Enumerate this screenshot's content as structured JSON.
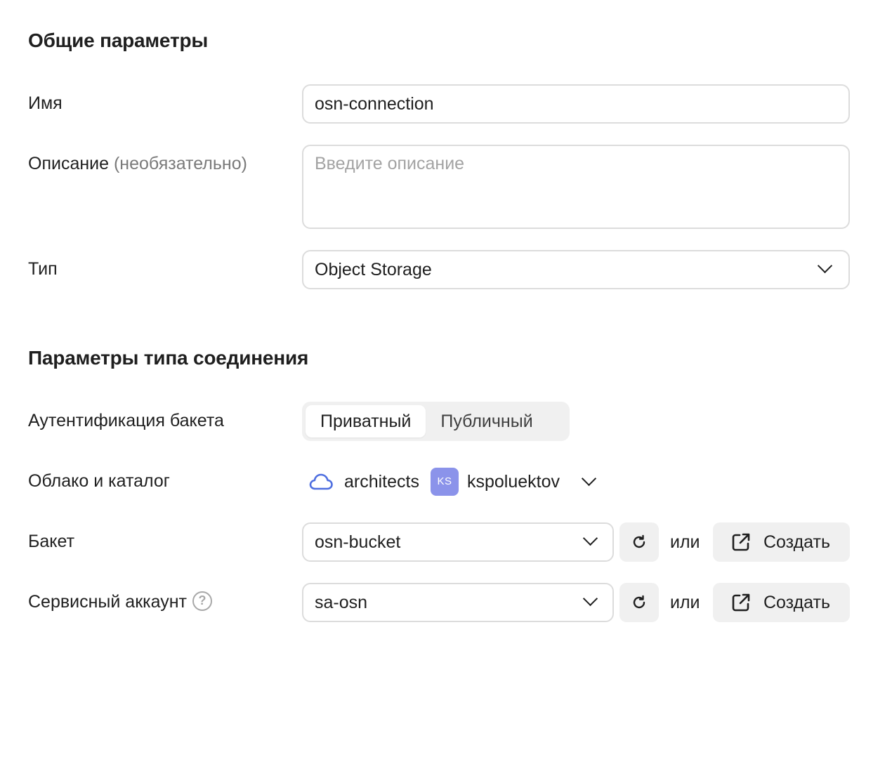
{
  "general": {
    "title": "Общие параметры",
    "name_label": "Имя",
    "name_value": "osn-connection",
    "description_label": "Описание",
    "description_hint": "(необязательно)",
    "description_placeholder": "Введите описание",
    "type_label": "Тип",
    "type_value": "Object Storage"
  },
  "connection": {
    "title": "Параметры типа соединения",
    "auth_label": "Аутентификация бакета",
    "auth_options": [
      "Приватный",
      "Публичный"
    ],
    "auth_selected": "Приватный",
    "cloud_label": "Облако и каталог",
    "cloud_name": "architects",
    "folder_badge": "KS",
    "folder_name": "kspoluektov",
    "badge_color": "#8b93ea",
    "bucket_label": "Бакет",
    "bucket_value": "osn-bucket",
    "or_text": "или",
    "create_label": "Создать",
    "sa_label": "Сервисный аккаунт",
    "sa_value": "sa-osn",
    "help_symbol": "?"
  }
}
